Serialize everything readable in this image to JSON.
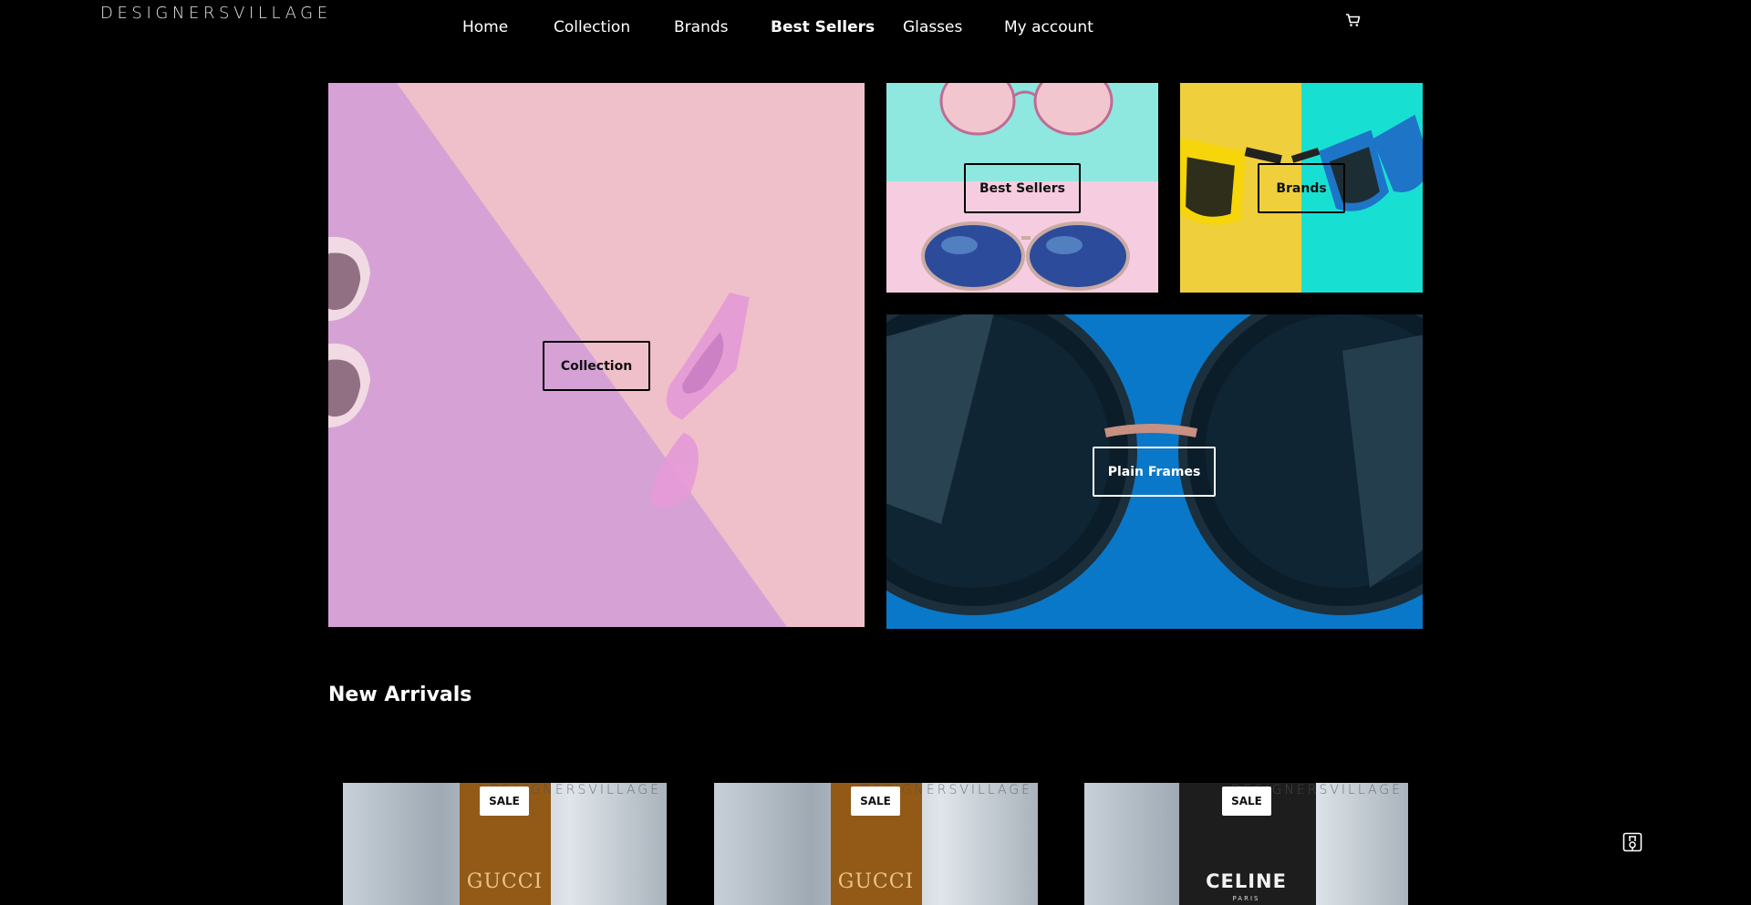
{
  "header": {
    "logo": "DESIGNERSVILLAGE",
    "nav": [
      {
        "label": "Home"
      },
      {
        "label": "Collection"
      },
      {
        "label": "Brands"
      },
      {
        "label": "Best Sellers",
        "active": true
      },
      {
        "label": "Glasses"
      },
      {
        "label": "My account"
      }
    ],
    "cart_icon": "cart-icon"
  },
  "tiles": {
    "collection": {
      "label": "Collection"
    },
    "best_sellers": {
      "label": "Best Sellers"
    },
    "brands": {
      "label": "Brands"
    },
    "plain_frames": {
      "label": "Plain Frames"
    }
  },
  "new_arrivals": {
    "title": "New Arrivals",
    "products": [
      {
        "badge": "SALE",
        "watermark": "DESIGNERSVILLAGE",
        "brand": "GUCCI",
        "brand_sub": ""
      },
      {
        "badge": "SALE",
        "watermark": "DESIGNERSVILLAGE",
        "brand": "GUCCI",
        "brand_sub": ""
      },
      {
        "badge": "SALE",
        "watermark": "DESIGNERSVILLAGE",
        "brand": "CELINE",
        "brand_sub": "PARIS"
      }
    ]
  },
  "colors": {
    "background": "#000000",
    "text": "#ffffff",
    "collection_pink": "#efc0c9",
    "collection_purple": "#d8a3d8",
    "aqua": "#8ee8e0",
    "blue": "#0a78c8",
    "yellow": "#f0cf3c"
  },
  "icons": {
    "chat": "chat-icon"
  }
}
